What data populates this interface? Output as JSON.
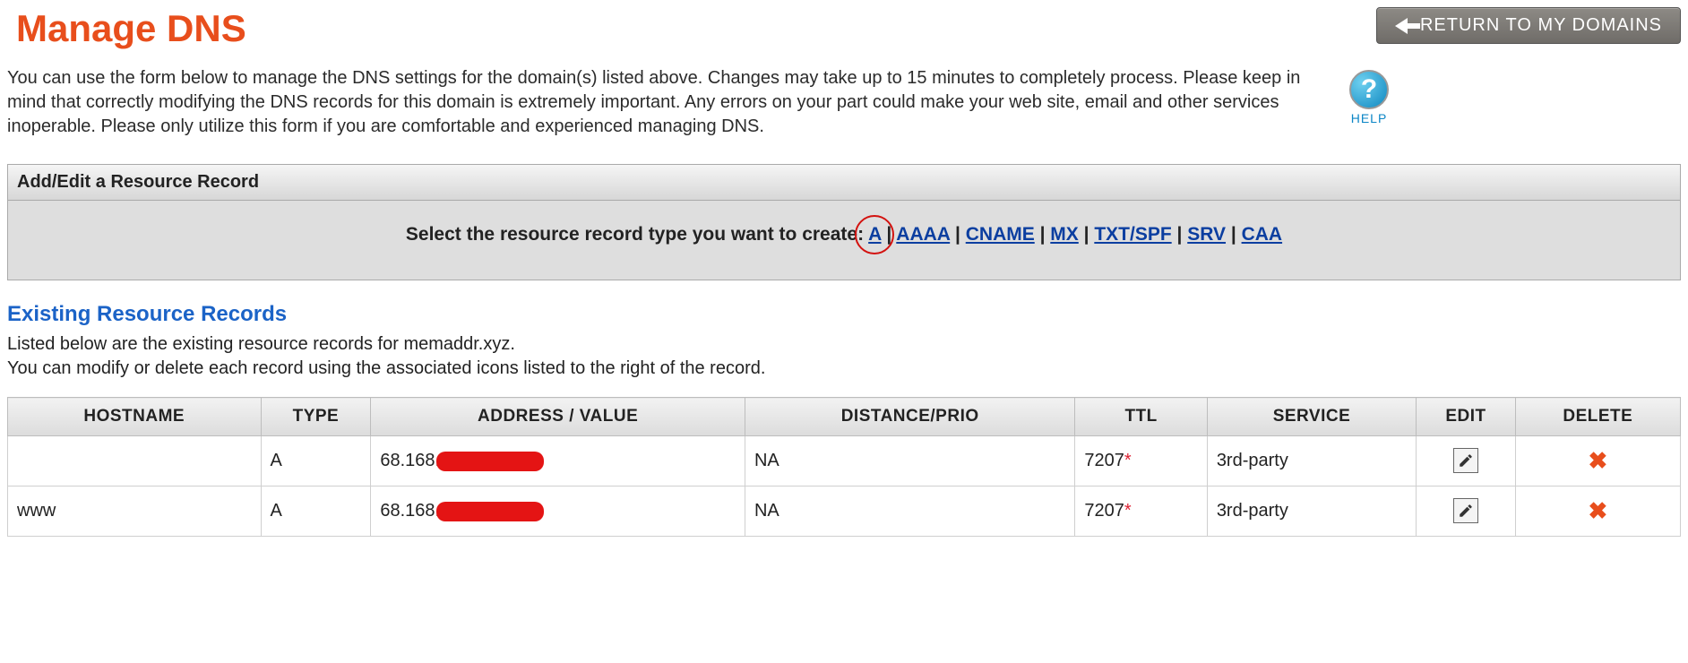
{
  "header": {
    "title": "Manage DNS",
    "return_label": "RETURN TO MY DOMAINS"
  },
  "intro_text": "You can use the form below to manage the DNS settings for the domain(s) listed above. Changes may take up to 15 minutes to completely process. Please keep in mind that correctly modifying the DNS records for this domain is extremely important. Any errors on your part could make your web site, email and other services inoperable. Please only utilize this form if you are comfortable and experienced managing DNS.",
  "help": {
    "label": "HELP",
    "glyph": "?"
  },
  "add_panel": {
    "head": "Add/Edit a Resource Record",
    "prompt": "Select the resource record type you want to create:",
    "types": [
      "A",
      "AAAA",
      "CNAME",
      "MX",
      "TXT/SPF",
      "SRV",
      "CAA"
    ]
  },
  "existing": {
    "title": "Existing Resource Records",
    "desc_line1": "Listed below are the existing resource records for memaddr.xyz.",
    "desc_line2": "You can modify or delete each record using the associated icons listed to the right of the record.",
    "columns": {
      "hostname": "HOSTNAME",
      "type": "TYPE",
      "address": "ADDRESS / VALUE",
      "distance": "DISTANCE/PRIO",
      "ttl": "TTL",
      "service": "SERVICE",
      "edit": "EDIT",
      "delete": "DELETE"
    },
    "rows": [
      {
        "hostname": "",
        "type": "A",
        "address_prefix": "68.168.",
        "address_redacted": true,
        "distance": "NA",
        "ttl": "7207",
        "ttl_star": "*",
        "service": "3rd-party"
      },
      {
        "hostname": "www",
        "type": "A",
        "address_prefix": "68.168.",
        "address_redacted": true,
        "distance": "NA",
        "ttl": "7207",
        "ttl_star": "*",
        "service": "3rd-party"
      }
    ]
  }
}
